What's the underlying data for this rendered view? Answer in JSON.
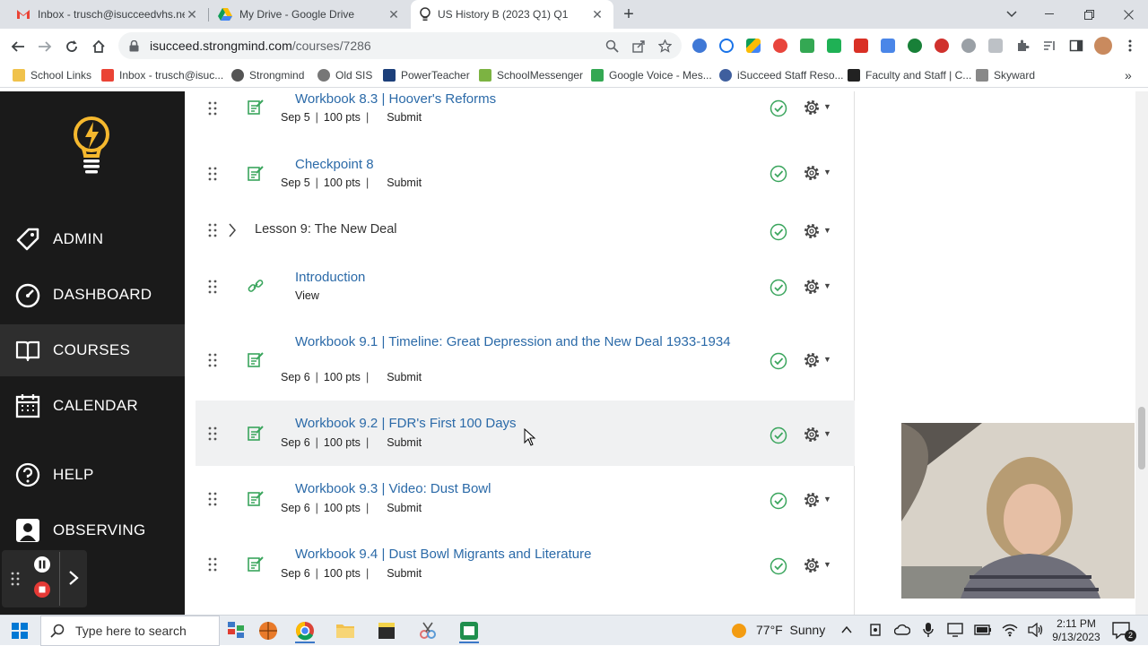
{
  "browser": {
    "tabs": [
      {
        "title": "Inbox - trusch@isucceedvhs.net",
        "icon": "gmail-icon"
      },
      {
        "title": "My Drive - Google Drive",
        "icon": "google-drive-icon"
      },
      {
        "title": "US History B (2023 Q1) Q1",
        "icon": "strongmind-bulb-icon"
      }
    ],
    "url_host": "isucceed.strongmind.com",
    "url_path": "/courses/7286",
    "bookmarks": [
      "School Links",
      "Inbox - trusch@isuc...",
      "Strongmind",
      "Old SIS",
      "PowerTeacher",
      "SchoolMessenger",
      "Google Voice - Mes...",
      "iSucceed Staff Reso...",
      "Faculty and Staff | C...",
      "Skyward"
    ],
    "more_bookmarks": "»"
  },
  "sidebar": {
    "items": [
      {
        "label": "ADMIN",
        "icon": "admin-tag-icon"
      },
      {
        "label": "DASHBOARD",
        "icon": "dashboard-gauge-icon"
      },
      {
        "label": "COURSES",
        "icon": "book-icon"
      },
      {
        "label": "CALENDAR",
        "icon": "calendar-icon"
      },
      {
        "label": "HELP",
        "icon": "help-icon"
      },
      {
        "label": "OBSERVING",
        "icon": "observing-person-icon"
      }
    ],
    "active": "COURSES"
  },
  "course": {
    "items": [
      {
        "title": "Workbook 8.3 | Hoover's Reforms",
        "date": "Sep 5",
        "points": "100 pts",
        "sep": "|",
        "action": "Submit"
      },
      {
        "title": "Checkpoint 8",
        "date": "Sep 5",
        "points": "100 pts",
        "sep": "|",
        "action": "Submit"
      },
      {
        "lesson": "Lesson 9: The New Deal"
      },
      {
        "title": "Introduction",
        "action": "View"
      },
      {
        "title": "Workbook 9.1 | Timeline: Great Depression and the New Deal 1933-1934",
        "date": "Sep 6",
        "points": "100 pts",
        "sep": "|",
        "action": "Submit"
      },
      {
        "title": "Workbook 9.2 | FDR's First 100 Days",
        "date": "Sep 6",
        "points": "100 pts",
        "sep": "|",
        "action": "Submit"
      },
      {
        "title": "Workbook 9.3 | Video: Dust Bowl",
        "date": "Sep 6",
        "points": "100 pts",
        "sep": "|",
        "action": "Submit"
      },
      {
        "title": "Workbook 9.4 | Dust Bowl Migrants and Literature",
        "date": "Sep 6",
        "points": "100 pts",
        "sep": "|",
        "action": "Submit"
      }
    ]
  },
  "taskbar": {
    "search_placeholder": "Type here to search",
    "weather": "77°F  Sunny",
    "time": "2:11 PM",
    "date": "9/13/2023",
    "notifications": "2"
  },
  "colors": {
    "link": "#2b6aa8",
    "check": "#3aa55d",
    "sidebar_bg": "#1a1a1a",
    "logo": "#f5b82e"
  }
}
